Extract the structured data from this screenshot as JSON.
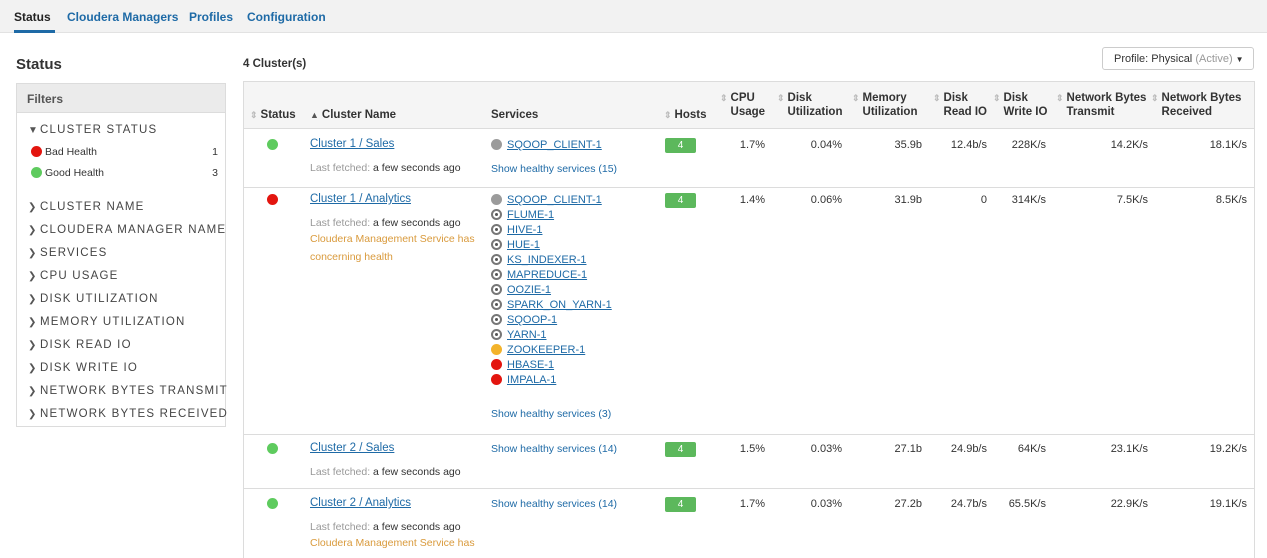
{
  "nav": {
    "tabs": [
      "Status",
      "Cloudera Managers",
      "Profiles",
      "Configuration"
    ]
  },
  "left": {
    "title": "Status",
    "filters_title": "Filters",
    "cluster_status": {
      "label": "CLUSTER STATUS",
      "items": [
        {
          "label": "Bad Health",
          "count": "1",
          "color": "#e3150f"
        },
        {
          "label": "Good Health",
          "count": "3",
          "color": "#5ecb5e"
        }
      ]
    },
    "sections": [
      "CLUSTER NAME",
      "CLOUDERA MANAGER NAME",
      "SERVICES",
      "CPU USAGE",
      "DISK UTILIZATION",
      "MEMORY UTILIZATION",
      "DISK READ IO",
      "DISK WRITE IO",
      "NETWORK BYTES TRANSMIT",
      "NETWORK BYTES RECEIVED"
    ]
  },
  "main": {
    "count": "4 Cluster(s)",
    "profile": {
      "label": "Profile: Physical",
      "active": "(Active)"
    },
    "headers": {
      "status": "Status",
      "cluster_name": "Cluster Name",
      "services": "Services",
      "hosts": "Hosts",
      "cpu_1": "CPU",
      "cpu_2": "Usage",
      "disk_util_1": "Disk",
      "disk_util_2": "Utilization",
      "mem_1": "Memory",
      "mem_2": "Utilization",
      "dread_1": "Disk",
      "dread_2": "Read IO",
      "dwrite_1": "Disk",
      "dwrite_2": "Write IO",
      "nbt_1": "Network Bytes",
      "nbt_2": "Transmit",
      "nbr_1": "Network Bytes",
      "nbr_2": "Received"
    },
    "fetched_label": "Last fetched:",
    "fetched_value": "a few seconds ago",
    "rows": [
      {
        "name": "Cluster 1 / Sales",
        "health": "good",
        "services": [
          {
            "name": "SQOOP_CLIENT-1",
            "state": "grey"
          }
        ],
        "healthy": "Show healthy services (15)",
        "hosts": "4",
        "cpu": "1.7%",
        "disk_util": "0.04%",
        "mem": "35.9b",
        "dread": "12.4b/s",
        "dwrite": "228K/s",
        "nbt": "14.2K/s",
        "nbr": "18.1K/s"
      },
      {
        "name": "Cluster 1 / Analytics",
        "health": "bad",
        "warning": "Cloudera Management Service has concerning health",
        "services": [
          {
            "name": "SQOOP_CLIENT-1",
            "state": "grey"
          },
          {
            "name": "FLUME-1",
            "state": "stopped"
          },
          {
            "name": "HIVE-1",
            "state": "stopped"
          },
          {
            "name": "HUE-1",
            "state": "stopped"
          },
          {
            "name": "KS_INDEXER-1",
            "state": "stopped"
          },
          {
            "name": "MAPREDUCE-1",
            "state": "stopped"
          },
          {
            "name": "OOZIE-1",
            "state": "stopped"
          },
          {
            "name": "SPARK_ON_YARN-1",
            "state": "stopped"
          },
          {
            "name": "SQOOP-1",
            "state": "stopped"
          },
          {
            "name": "YARN-1",
            "state": "stopped"
          },
          {
            "name": "ZOOKEEPER-1",
            "state": "amber"
          },
          {
            "name": "HBASE-1",
            "state": "red"
          },
          {
            "name": "IMPALA-1",
            "state": "red"
          }
        ],
        "healthy": "Show healthy services (3)",
        "hosts": "4",
        "cpu": "1.4%",
        "disk_util": "0.06%",
        "mem": "31.9b",
        "dread": "0",
        "dwrite": "314K/s",
        "nbt": "7.5K/s",
        "nbr": "8.5K/s"
      },
      {
        "name": "Cluster 2 / Sales",
        "health": "good",
        "services": [],
        "healthy": "Show healthy services (14)",
        "hosts": "4",
        "cpu": "1.5%",
        "disk_util": "0.03%",
        "mem": "27.1b",
        "dread": "24.9b/s",
        "dwrite": "64K/s",
        "nbt": "23.1K/s",
        "nbr": "19.2K/s"
      },
      {
        "name": "Cluster 2 / Analytics",
        "health": "good",
        "warning": "Cloudera Management Service has",
        "services": [],
        "healthy": "Show healthy services (14)",
        "hosts": "4",
        "cpu": "1.7%",
        "disk_util": "0.03%",
        "mem": "27.2b",
        "dread": "24.7b/s",
        "dwrite": "65.5K/s",
        "nbt": "22.9K/s",
        "nbr": "19.1K/s"
      }
    ]
  },
  "colors": {
    "link": "#1e6aa6",
    "good": "#5ecb5e",
    "bad": "#e3150f",
    "concerning": "#f3b32b",
    "hosts_badge": "#5cb85c",
    "warning_text": "#d99a3c"
  }
}
